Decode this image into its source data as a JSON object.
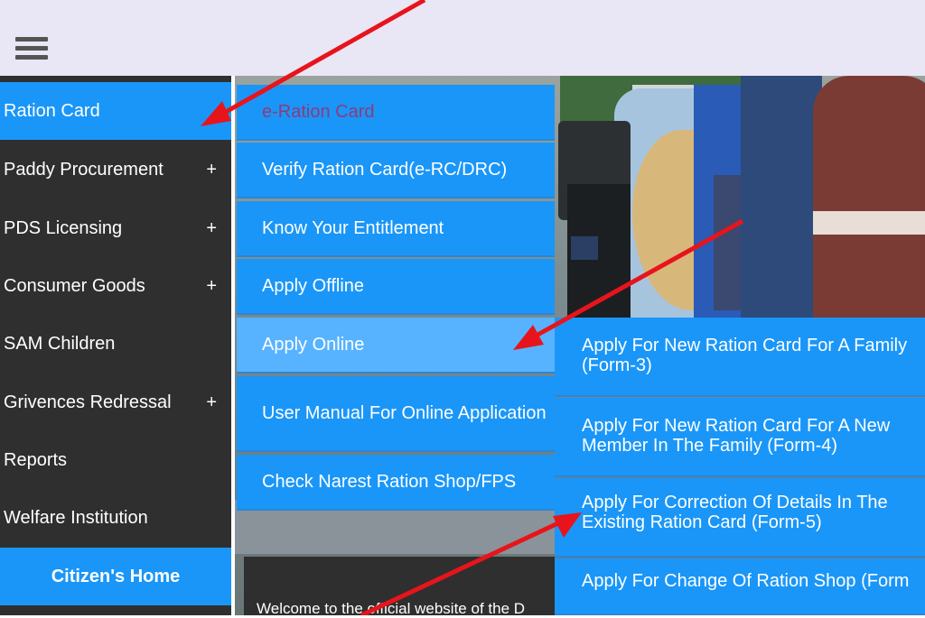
{
  "sidebar": {
    "items": [
      {
        "label": "Ration Card",
        "plus": ""
      },
      {
        "label": "Paddy Procurement",
        "plus": "+"
      },
      {
        "label": "PDS Licensing",
        "plus": "+"
      },
      {
        "label": "Consumer Goods",
        "plus": "+"
      },
      {
        "label": "SAM Children",
        "plus": ""
      },
      {
        "label": "Grivences Redressal",
        "plus": "+"
      },
      {
        "label": "Reports",
        "plus": ""
      },
      {
        "label": "Welfare Institution",
        "plus": ""
      }
    ],
    "citizen_home": "Citizen's Home"
  },
  "ration_submenu": {
    "items": [
      "e-Ration Card",
      "Verify Ration Card(e-RC/DRC)",
      "Know Your Entitlement",
      "Apply Offline",
      "Apply Online",
      "User Manual For Online Application",
      "Check Narest Ration Shop/FPS"
    ]
  },
  "apply_online_submenu": {
    "items": [
      "Apply For New Ration Card For A Family (Form-3)",
      "Apply For New Ration Card For A New Member In The Family (Form-4)",
      "Apply For Correction Of Details In The Existing Ration Card (Form-5)",
      "Apply For Change Of Ration Shop (Form"
    ]
  },
  "welcome_text": "Welcome to the official website of the D",
  "icons": {
    "menu": "hamburger-icon",
    "annotation": "red-arrow"
  },
  "colors": {
    "accent": "#1a96f8",
    "sidebar": "#2f2f2f",
    "arrow": "#e8141b"
  }
}
